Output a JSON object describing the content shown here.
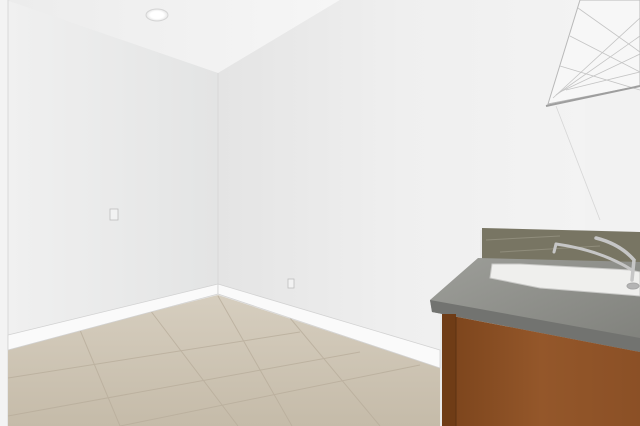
{
  "scene": {
    "description_free": true,
    "colors": {
      "ceiling": "#f4f4f4",
      "left_wall": "#e8e9e9",
      "back_wall_light": "#efefef",
      "back_wall_shadow": "#e2e2e2",
      "right_wall": "#f1f1f1",
      "baseboard": "#f8f8f8",
      "floor": "#cbc1b0",
      "floor_grout": "#b8ad9b",
      "counter": "#8e8f8b",
      "backsplash": "#7a7766",
      "sink": "#eeeeec",
      "cabinet": "#8a4f22",
      "cabinet_dark": "#6e3d18",
      "faucet": "#c8c8c8",
      "shelf": "#f8f8f8",
      "outlet": "#f0f0f0",
      "light": "#ffffff"
    },
    "icons": [
      "recessed-light-icon",
      "light-switch-icon",
      "power-outlet-icon",
      "faucet-icon"
    ]
  }
}
